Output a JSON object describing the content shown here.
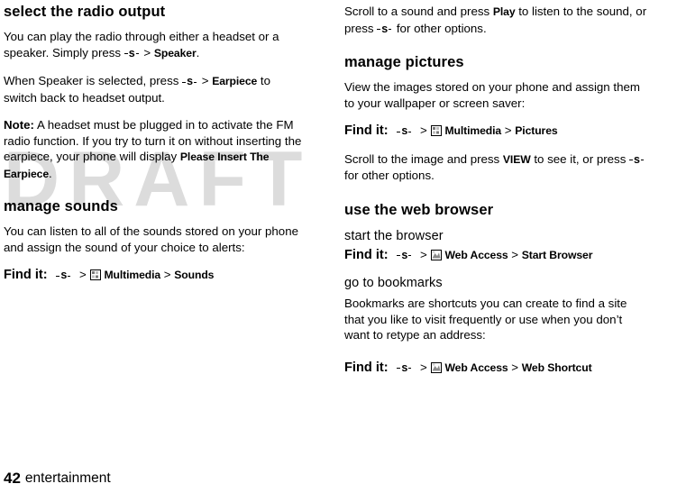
{
  "watermark": "DRAFT",
  "footer": {
    "page_number": "42",
    "section": "entertainment"
  },
  "left_column": {
    "sections": [
      {
        "heading": "select the radio output",
        "paragraphs": [
          {
            "id": "p1",
            "pre": "You can play the radio through either a headset or a speaker. Simply press ",
            "key": "s",
            "mid": " > ",
            "bold1": "Speaker",
            "post": "."
          },
          {
            "id": "p2",
            "pre": "When Speaker is selected, press ",
            "key": "s",
            "mid": " > ",
            "bold1": "Earpiece",
            "post": " to switch back to headset output."
          },
          {
            "id": "p3",
            "note_label": "Note:",
            "text1": " A headset must be plugged in to activate the FM radio function. If you try to turn it on without inserting the earpiece, your phone will display ",
            "bold1": "Please Insert The Earpiece",
            "text2": "."
          }
        ]
      },
      {
        "heading": "manage sounds",
        "paragraphs": [
          {
            "id": "p4",
            "text": "You can listen to all of the sounds stored on your phone and assign the sound of your choice to alerts:"
          }
        ],
        "find_it": {
          "label": "Find it:",
          "key": "s",
          "sep1": " > ",
          "icon": "multimedia-icon",
          "item1": "Multimedia",
          "sep2": " > ",
          "item2": "Sounds"
        }
      }
    ]
  },
  "right_column": {
    "intro": {
      "pre": "Scroll to a sound and press ",
      "bold1": "Play",
      "mid": " to listen to the sound, or press ",
      "key": "s",
      "post": " for other options."
    },
    "sections": [
      {
        "heading": "manage pictures",
        "paragraphs": [
          {
            "id": "r1",
            "text": "View the images stored on your phone and assign them to your wallpaper or screen saver:"
          }
        ],
        "find_it": {
          "label": "Find it:",
          "key": "s",
          "sep1": " > ",
          "icon": "multimedia-icon",
          "item1": "Multimedia",
          "sep2": " > ",
          "item2": "Pictures"
        },
        "after": {
          "pre": "Scroll to the image and press ",
          "bold1": "VIEW",
          "mid": " to see it, or press ",
          "key": "s",
          "post": " for other options."
        }
      },
      {
        "heading": "use the web browser",
        "subsections": [
          {
            "subheading": "start the browser",
            "find_it": {
              "label": "Find it:",
              "key": "s",
              "sep1": " > ",
              "icon": "web-access-icon",
              "item1": "Web Access",
              "sep2": " > ",
              "item2": "Start Browser"
            }
          },
          {
            "subheading": "go to bookmarks",
            "paragraph": "Bookmarks are shortcuts you can create to find a site that you like to visit frequently or use when you don’t want to retype an address:",
            "find_it": {
              "label": "Find it:",
              "key": "s",
              "sep1": " > ",
              "icon": "web-access-icon",
              "item1": "Web Access",
              "sep2": " > ",
              "item2": "Web Shortcut"
            }
          }
        ]
      }
    ]
  }
}
